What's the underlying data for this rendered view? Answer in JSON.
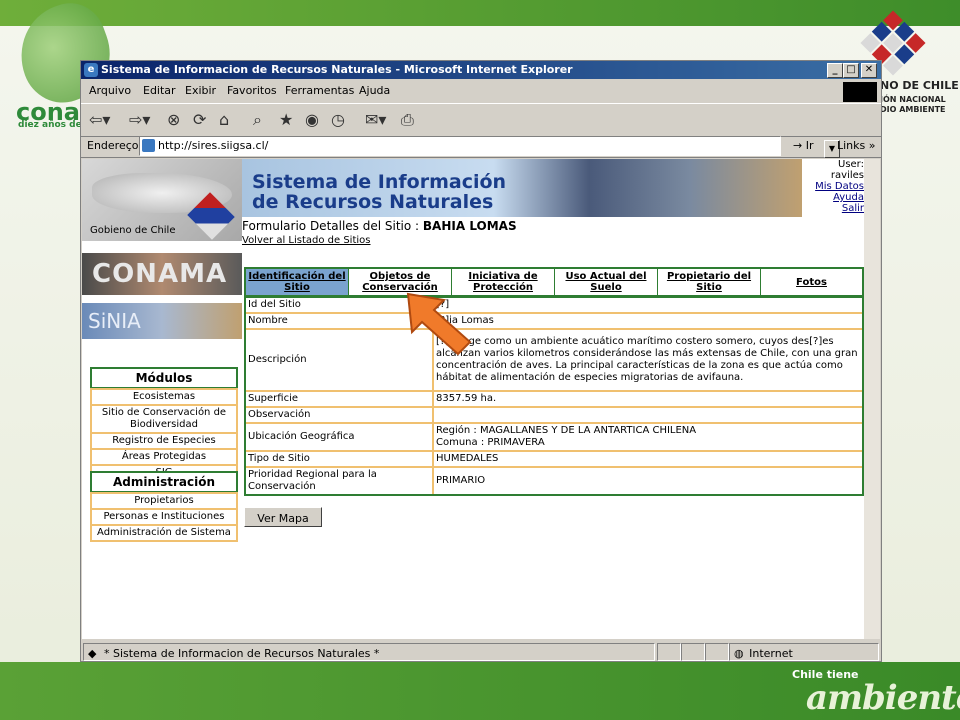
{
  "slide": {
    "conam_logo": "conam",
    "conam_sub": "diez años de",
    "gov_line1": "NO DE CHILE",
    "gov_line2": "IÓN NACIONAL",
    "gov_line3": "DIO AMBIENTE",
    "footer_small": "Chile tiene",
    "footer_big": "ambiente"
  },
  "window": {
    "title": "Sistema de Informacion de Recursos Naturales - Microsoft Internet Explorer"
  },
  "menu": [
    "Arquivo",
    "Editar",
    "Exibir",
    "Favoritos",
    "Ferramentas",
    "Ajuda"
  ],
  "address": {
    "label": "Endereço",
    "url": "http://sires.siigsa.cl/",
    "go_label": "Ir",
    "links_label": "Links »"
  },
  "page": {
    "logo_caption": "Gobieno de Chile",
    "banner_line1": "Sistema de Información",
    "banner_line2": "de Recursos Naturales",
    "user_label": "User:",
    "user_name": "raviles",
    "user_links": [
      "Mis Datos",
      "Ayuda",
      "Salir"
    ],
    "form_title_prefix": "Formulario Detalles del Sitio : ",
    "form_title_site": "BAHIA LOMAS",
    "back_link": "Volver al Listado de Sitios",
    "side_img1": "CONAMA",
    "side_img2": "SiNIA"
  },
  "modules": {
    "heading": "Módulos",
    "items": [
      "Ecosistemas",
      "Sitio de Conservación de Biodiversidad",
      "Registro de Especies",
      "Áreas Protegidas",
      "SIG"
    ]
  },
  "admin": {
    "heading": "Administración",
    "items": [
      "Propietarios",
      "Personas e Instituciones",
      "Administración de Sistema"
    ]
  },
  "tabs": [
    "Identificación del Sitio",
    "Objetos de Conservación",
    "Iniciativa de Protección",
    "Uso Actual del Suelo",
    "Propietario del Sitio",
    "Fotos"
  ],
  "details": [
    {
      "label": "Id del Sitio",
      "value": "[?]"
    },
    {
      "label": "Nombre",
      "value": "[?]ia Lomas"
    },
    {
      "label": "Descripción",
      "value": "[?]utinge como un ambiente acuático marítimo costero somero, cuyos des[?]es alcanzan varios kilometros considerándose las más extensas de Chile, con una gran concentración de aves. La principal características de la zona es que actúa como hábitat de alimentación de especies migratorias de avifauna."
    },
    {
      "label": "Superficie",
      "value": "8357.59 ha."
    },
    {
      "label": "Observación",
      "value": ""
    },
    {
      "label": "Ubicación Geográfica",
      "value": "Región : MAGALLANES Y DE LA ANTARTICA CHILENA\nComuna : PRIMAVERA"
    },
    {
      "label": "Tipo de Sitio",
      "value": "HUMEDALES"
    },
    {
      "label": "Prioridad Regional para la Conservación",
      "value": "PRIMARIO"
    }
  ],
  "button_map": "Ver Mapa",
  "status": {
    "text": "Sistema de Informacion de Recursos Naturales",
    "zone": "Internet"
  }
}
